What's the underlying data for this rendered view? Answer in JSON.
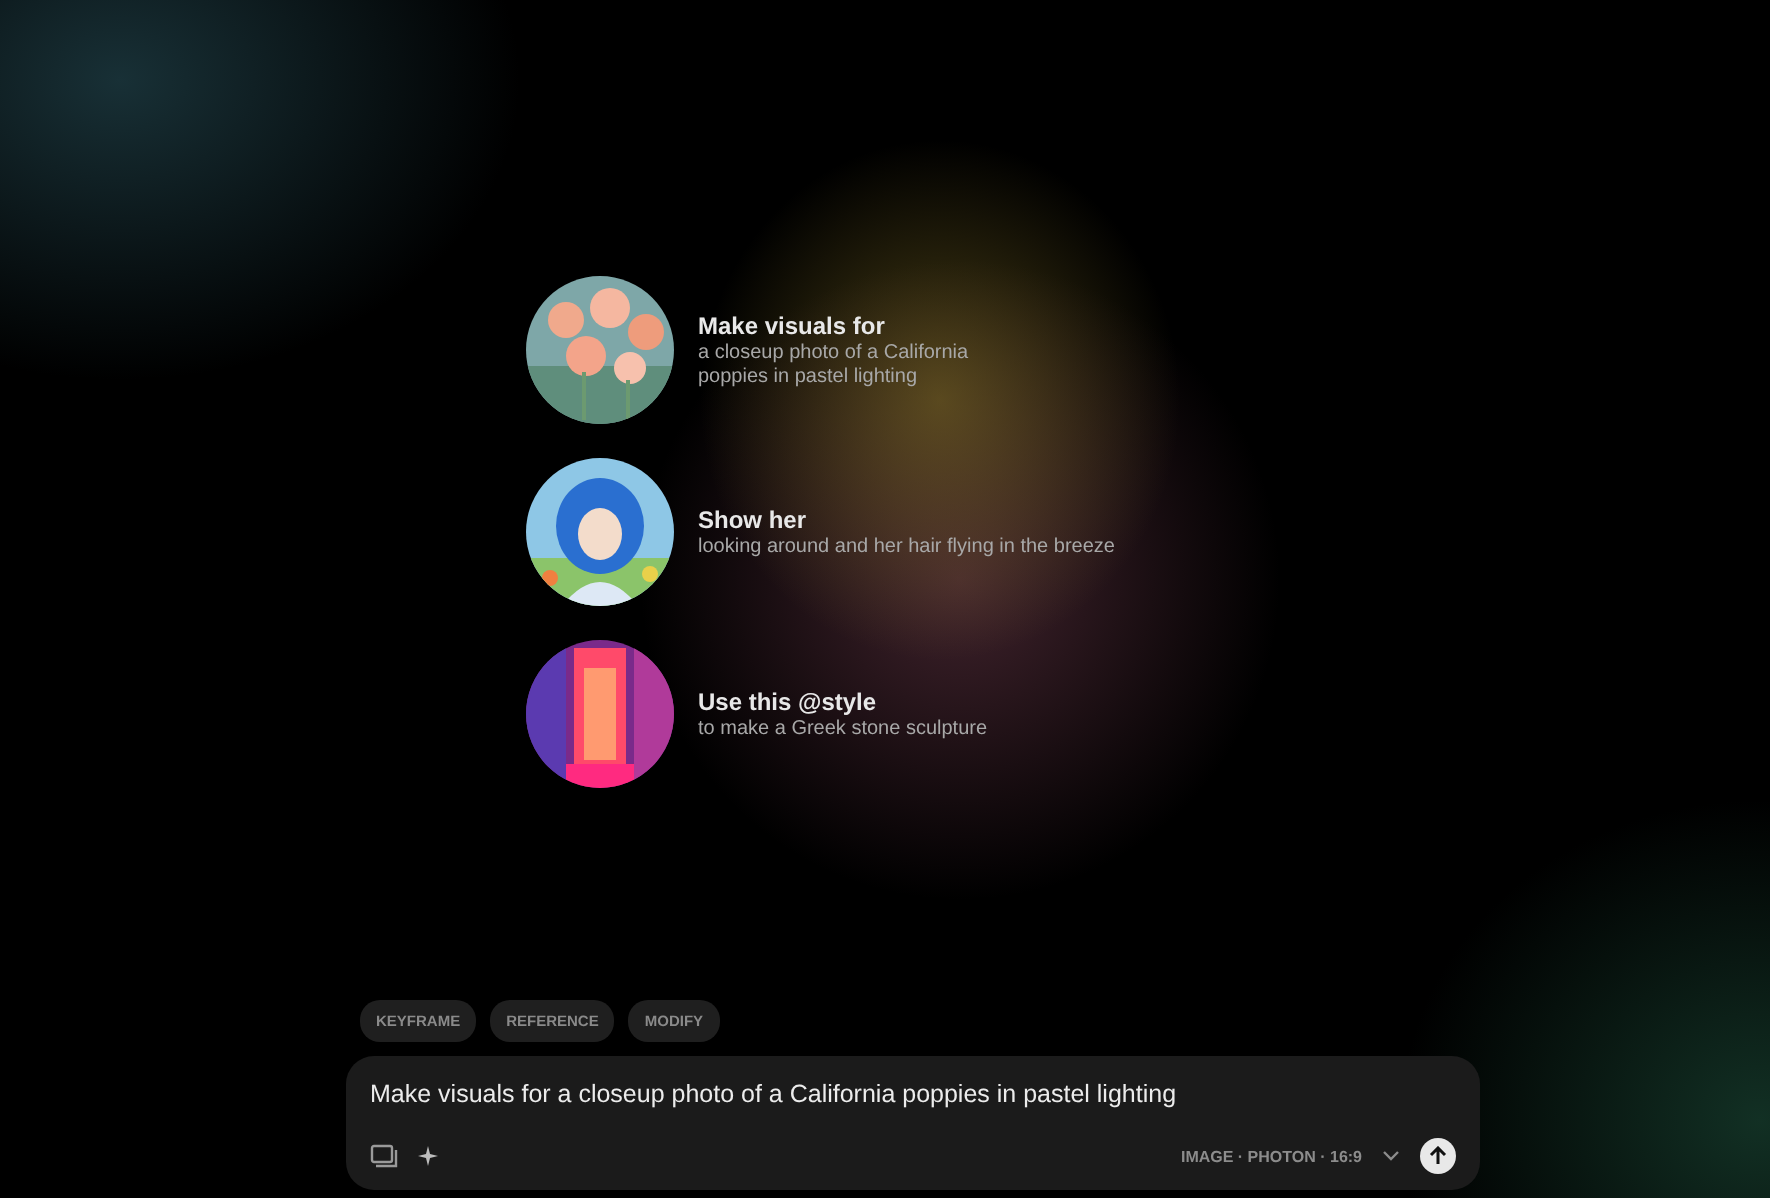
{
  "suggestions": [
    {
      "title": "Make visuals for",
      "subtitle": "a closeup photo of a California poppies in pastel lighting"
    },
    {
      "title": "Show her",
      "subtitle": "looking around and her hair flying in the breeze"
    },
    {
      "title": "Use this @style",
      "subtitle": "to make a Greek stone sculpture"
    }
  ],
  "chips": [
    "KEYFRAME",
    "REFERENCE",
    "MODIFY"
  ],
  "prompt": {
    "value": "Make visuals for a closeup photo of a California poppies in pastel lighting",
    "mode": "IMAGE · PHOTON · 16:9"
  }
}
